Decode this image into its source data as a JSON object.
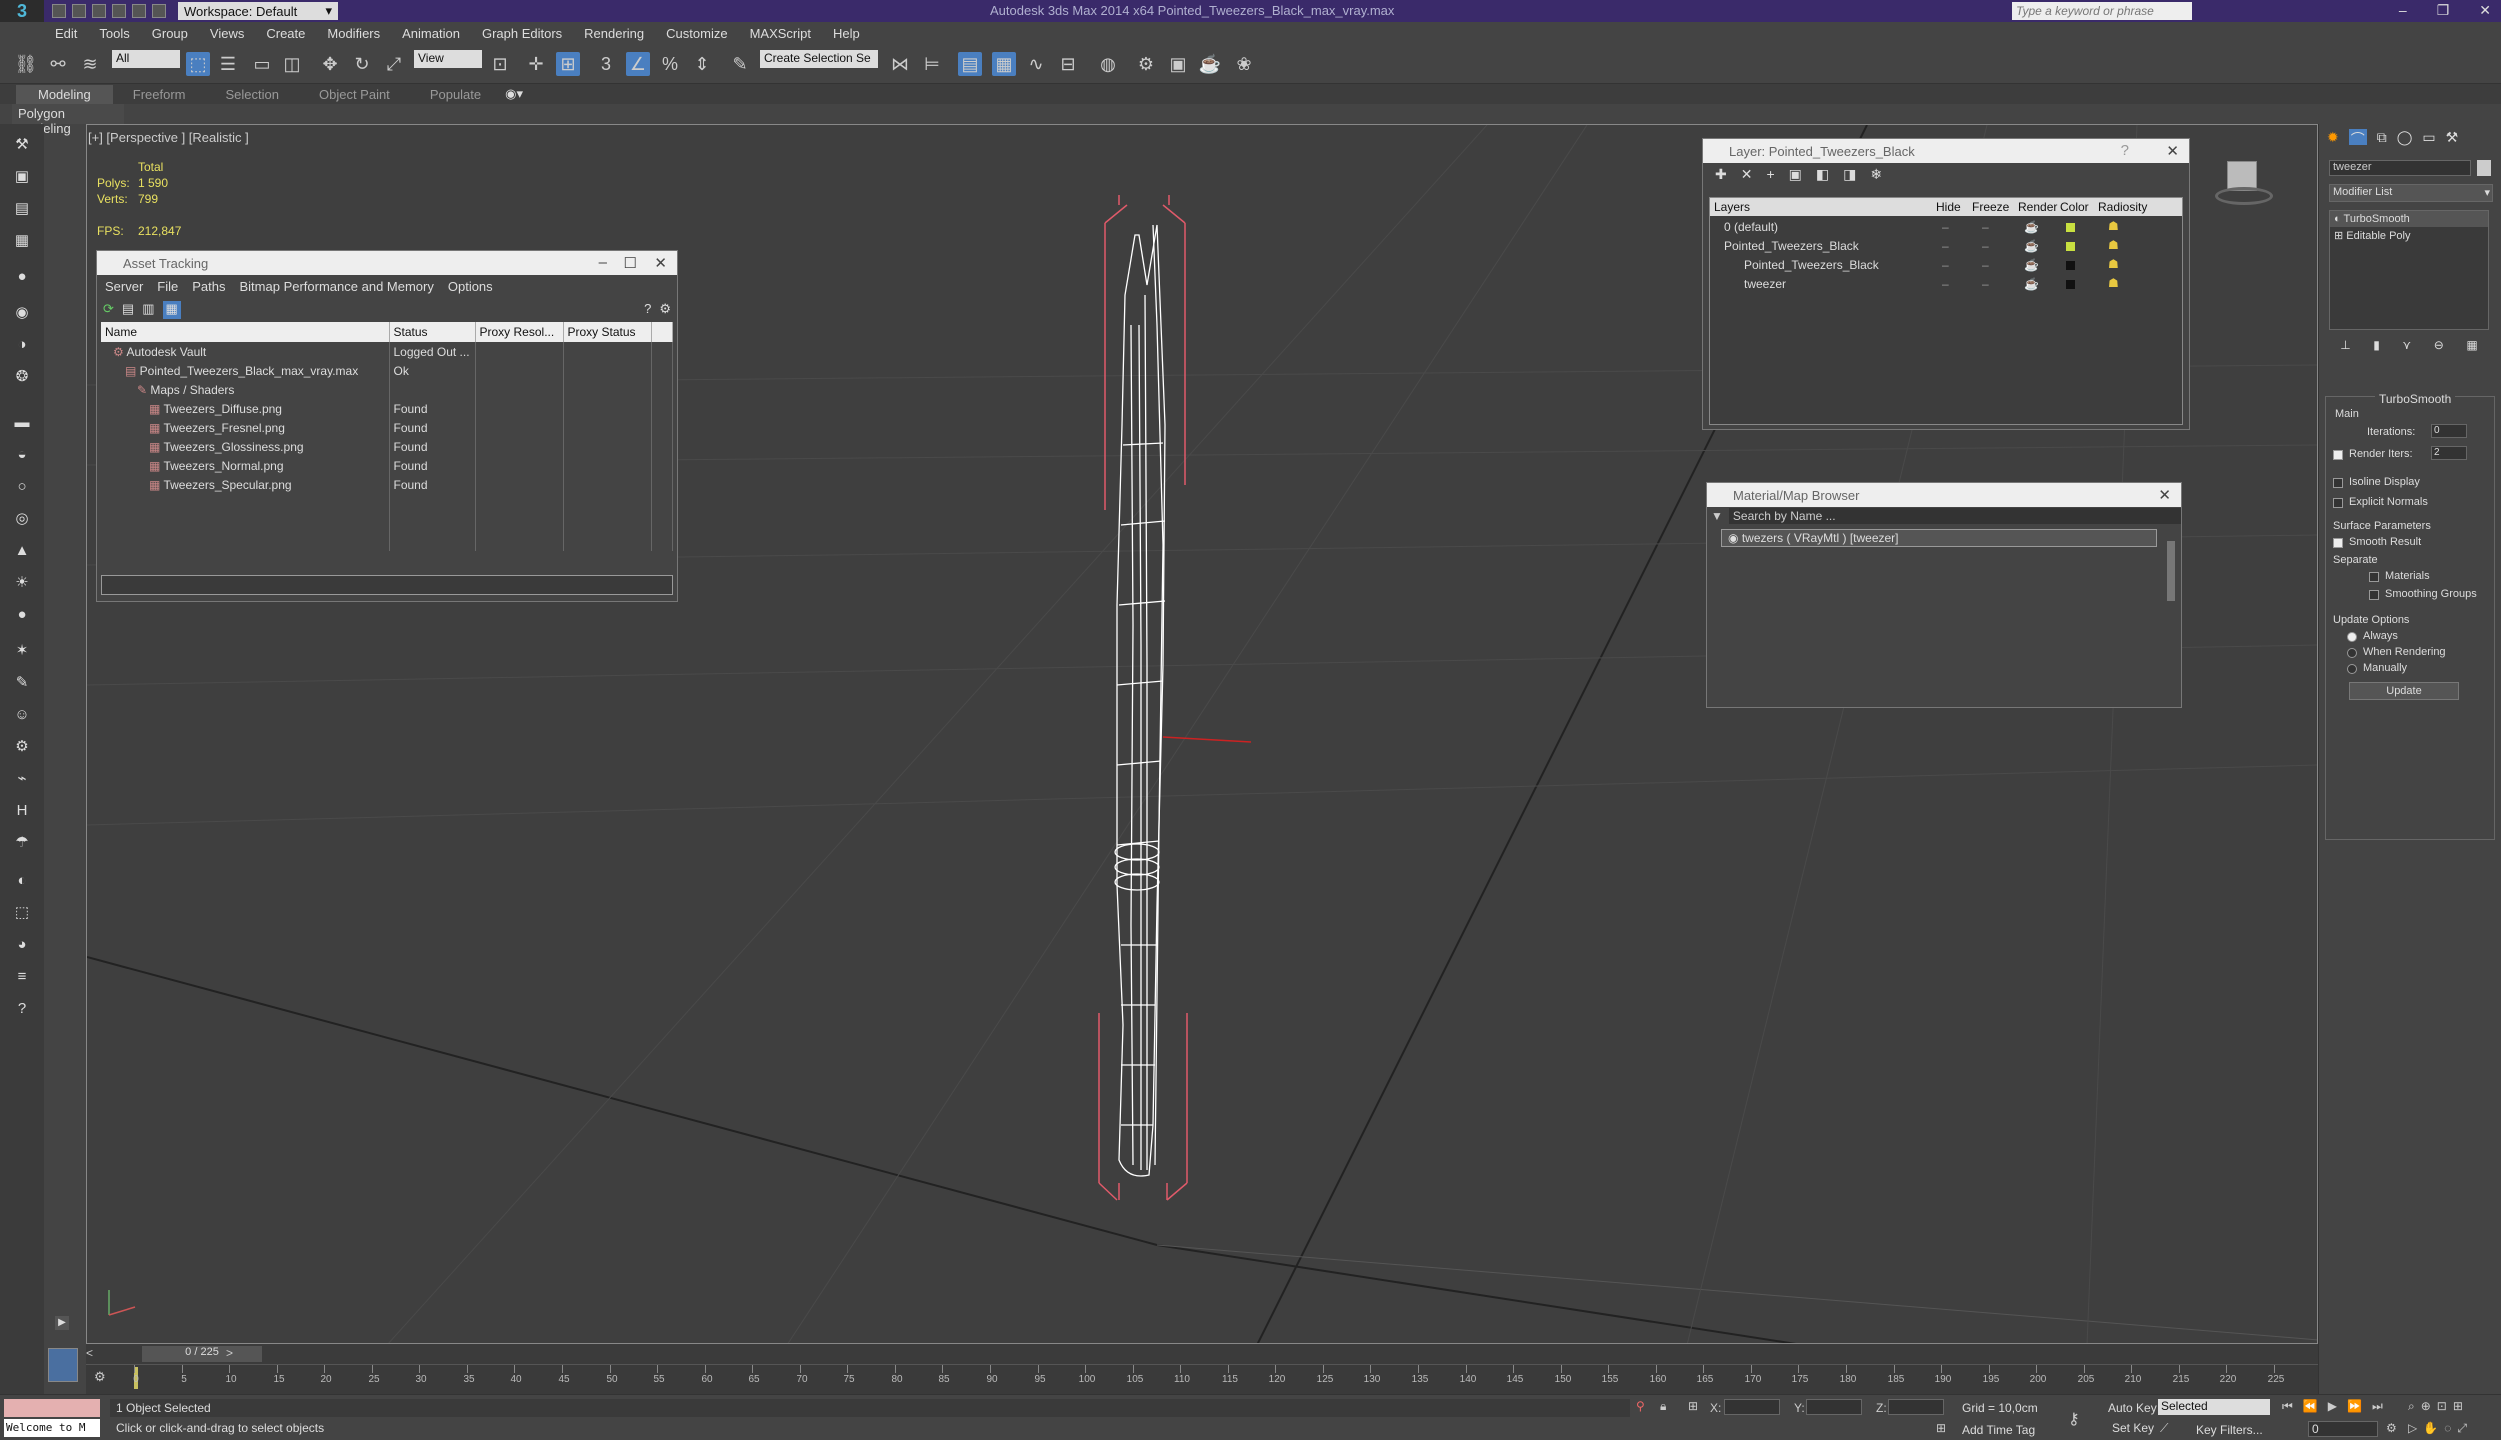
{
  "app": {
    "title": "Autodesk 3ds Max  2014 x64     Pointed_Tweezers_Black_max_vray.max",
    "workspace": "Workspace: Default",
    "search_placeholder": "Type a keyword or phrase"
  },
  "menu": [
    "Edit",
    "Tools",
    "Group",
    "Views",
    "Create",
    "Modifiers",
    "Animation",
    "Graph Editors",
    "Rendering",
    "Customize",
    "MAXScript",
    "Help"
  ],
  "toolbar": {
    "filter": "All",
    "coord": "View",
    "selection_set": "Create Selection Se"
  },
  "ribbon": {
    "tabs": [
      "Modeling",
      "Freeform",
      "Selection",
      "Object Paint",
      "Populate"
    ],
    "sub": "Polygon Modeling"
  },
  "viewport": {
    "label": "[+] [Perspective ] [Realistic ]",
    "stats_header": "Total",
    "polys_label": "Polys:",
    "polys": "1 590",
    "verts_label": "Verts:",
    "verts": "799",
    "fps_label": "FPS:",
    "fps": "212,847"
  },
  "asset_tracking": {
    "title": "Asset Tracking",
    "menu": [
      "Server",
      "File",
      "Paths",
      "Bitmap Performance and Memory",
      "Options"
    ],
    "columns": [
      "Name",
      "Status",
      "Proxy Resol...",
      "Proxy Status"
    ],
    "rows": [
      {
        "name": "Autodesk Vault",
        "status": "Logged Out ...",
        "indent": 1
      },
      {
        "name": "Pointed_Tweezers_Black_max_vray.max",
        "status": "Ok",
        "indent": 2
      },
      {
        "name": "Maps / Shaders",
        "status": "",
        "indent": 3
      },
      {
        "name": "Tweezers_Diffuse.png",
        "status": "Found",
        "indent": 4
      },
      {
        "name": "Tweezers_Fresnel.png",
        "status": "Found",
        "indent": 4
      },
      {
        "name": "Tweezers_Glossiness.png",
        "status": "Found",
        "indent": 4
      },
      {
        "name": "Tweezers_Normal.png",
        "status": "Found",
        "indent": 4
      },
      {
        "name": "Tweezers_Specular.png",
        "status": "Found",
        "indent": 4
      }
    ]
  },
  "layer_panel": {
    "title": "Layer: Pointed_Tweezers_Black",
    "columns": [
      "Layers",
      "Hide",
      "Freeze",
      "Render",
      "Color",
      "Radiosity"
    ],
    "rows": [
      {
        "name": "0 (default)",
        "color": "#c8e040"
      },
      {
        "name": "Pointed_Tweezers_Black",
        "color": "#c8e040"
      },
      {
        "name": "Pointed_Tweezers_Black",
        "color": "#111111"
      },
      {
        "name": "tweezer",
        "color": "#111111"
      }
    ]
  },
  "material_browser": {
    "title": "Material/Map Browser",
    "search_placeholder": "Search by Name ...",
    "item": "twezers  ( VRayMtl )  [tweezer]"
  },
  "command_panel": {
    "object_name": "tweezer",
    "modifier_list": "Modifier List",
    "stack": [
      "TurboSmooth",
      "Editable Poly"
    ],
    "rollout": "TurboSmooth",
    "main": "Main",
    "iterations_label": "Iterations:",
    "iterations": "0",
    "render_iters_label": "Render Iters:",
    "render_iters": "2",
    "isoline": "Isoline Display",
    "explicit": "Explicit Normals",
    "surface": "Surface Parameters",
    "smooth_result": "Smooth Result",
    "separate": "Separate",
    "materials": "Materials",
    "smoothing_groups": "Smoothing Groups",
    "update_options": "Update Options",
    "always": "Always",
    "when_rendering": "When Rendering",
    "manually": "Manually",
    "update_btn": "Update"
  },
  "timeline": {
    "frame": "0 / 225",
    "ticks": [
      "0",
      "5",
      "10",
      "15",
      "20",
      "25",
      "30",
      "35",
      "40",
      "45",
      "50",
      "55",
      "60",
      "65",
      "70",
      "75",
      "80",
      "85",
      "90",
      "95",
      "100",
      "105",
      "110",
      "115",
      "120",
      "125",
      "130",
      "135",
      "140",
      "145",
      "150",
      "155",
      "160",
      "165",
      "170",
      "175",
      "180",
      "185",
      "190",
      "195",
      "200",
      "205",
      "210",
      "215",
      "220",
      "225"
    ]
  },
  "status": {
    "listener": "Welcome to M",
    "selected": "1 Object Selected",
    "hint": "Click or click-and-drag to select objects",
    "x_label": "X:",
    "y_label": "Y:",
    "z_label": "Z:",
    "grid": "Grid = 10,0cm",
    "add_time_tag": "Add Time Tag",
    "auto_key": "Auto Key",
    "set_key": "Set Key",
    "key_mode": "Selected",
    "key_filters": "Key Filters...",
    "frame_field": "0"
  }
}
